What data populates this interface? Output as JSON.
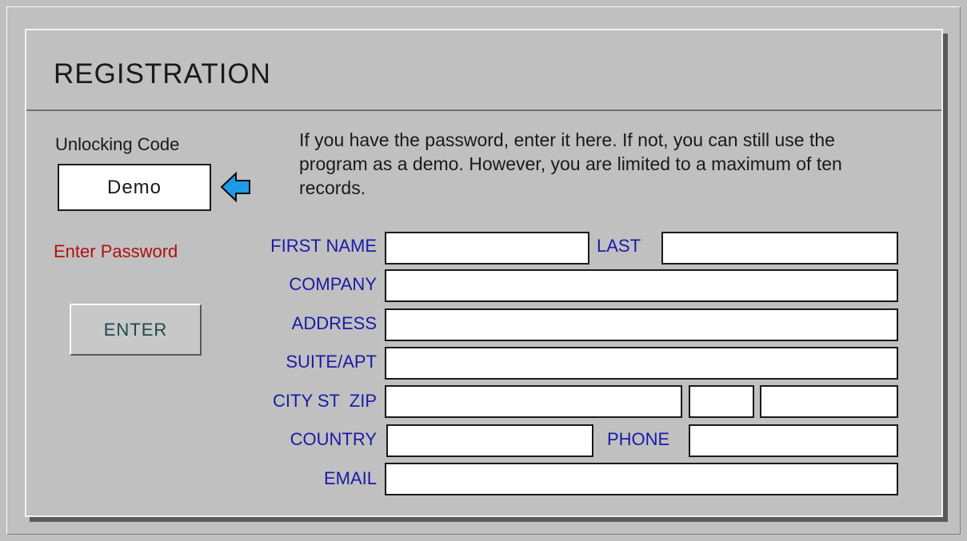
{
  "title": "REGISTRATION",
  "unlock": {
    "label": "Unlocking Code",
    "value": "Demo",
    "arrow_icon": "arrow-left-icon",
    "info": "If you have the password, enter it here. If not, you can still use the program as a demo. However, you are limited to a maximum of ten records."
  },
  "enter_password_label": "Enter Password",
  "enter_button_label": "ENTER",
  "fields": {
    "first_name_label": "FIRST NAME",
    "first_name_value": "",
    "last_label": "LAST",
    "last_value": "",
    "company_label": "COMPANY",
    "company_value": "",
    "address_label": "ADDRESS",
    "address_value": "",
    "suite_label": "SUITE/APT",
    "suite_value": "",
    "city_st_zip_label": "CITY ST  ZIP",
    "city_value": "",
    "state_value": "",
    "zip_value": "",
    "country_label": "COUNTRY",
    "country_value": "",
    "phone_label": "PHONE",
    "phone_value": "",
    "email_label": "EMAIL",
    "email_value": ""
  },
  "colors": {
    "background": "#c0c0c0",
    "label_blue": "#1a1aa8",
    "password_red": "#b01010",
    "arrow_fill": "#1e9be8"
  }
}
